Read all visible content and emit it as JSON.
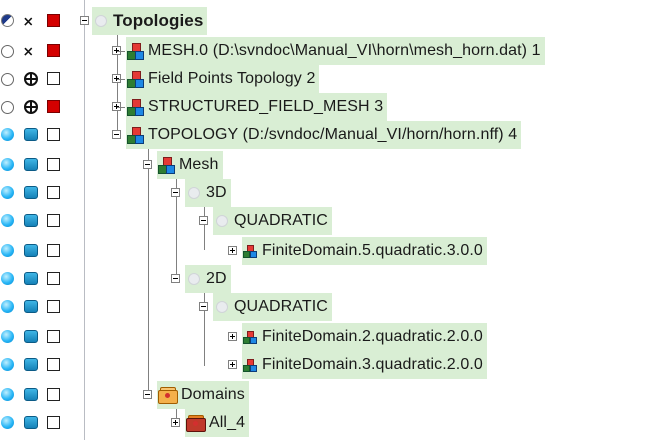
{
  "tree": {
    "rows": [
      {
        "label": "Topologies",
        "status": [
          "half",
          "mesh",
          "red"
        ]
      },
      {
        "label": "MESH.0 (D:\\svndoc\\Manual_VI\\horn\\mesh_horn.dat) 1",
        "status": [
          "empty",
          "mesh",
          "red"
        ]
      },
      {
        "label": "Field Points Topology 2",
        "status": [
          "empty",
          "grid",
          "box"
        ]
      },
      {
        "label": "STRUCTURED_FIELD_MESH 3",
        "status": [
          "empty",
          "grid",
          "red"
        ]
      },
      {
        "label": "TOPOLOGY (D:/svndoc/Manual_VI/horn/horn.nff) 4",
        "status": [
          "full",
          "cube",
          "box"
        ]
      },
      {
        "label": "Mesh",
        "status": [
          "full",
          "cube",
          "box"
        ]
      },
      {
        "label": "3D",
        "status": [
          "full",
          "cube",
          "box"
        ]
      },
      {
        "label": "QUADRATIC",
        "status": [
          "full",
          "cube",
          "box"
        ]
      },
      {
        "label": "FiniteDomain.5.quadratic.3.0.0",
        "status": [
          "full",
          "cube",
          "box"
        ]
      },
      {
        "label": "2D",
        "status": [
          "full",
          "cube",
          "box"
        ]
      },
      {
        "label": "QUADRATIC",
        "status": [
          "full",
          "cube",
          "box"
        ]
      },
      {
        "label": "FiniteDomain.2.quadratic.2.0.0",
        "status": [
          "full",
          "cube",
          "box"
        ]
      },
      {
        "label": "FiniteDomain.3.quadratic.2.0.0",
        "status": [
          "full",
          "cube",
          "box"
        ]
      },
      {
        "label": "Domains",
        "status": [
          "full",
          "cube",
          "box"
        ]
      },
      {
        "label": "All_4",
        "status": [
          "full",
          "cube",
          "box"
        ]
      }
    ]
  },
  "colors": {
    "node_highlight": "#d9eed4",
    "tree_line": "#808080",
    "status_red": "#d40000",
    "status_blue": "#29b6f6"
  }
}
